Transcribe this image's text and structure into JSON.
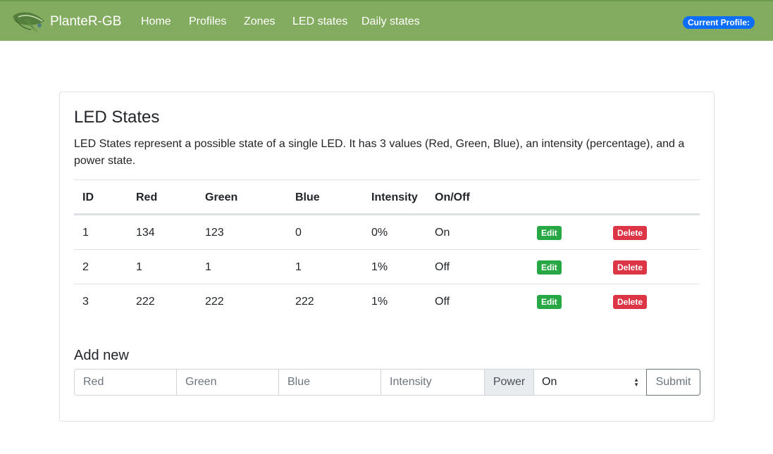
{
  "navbar": {
    "brand": "PlanteR-GB",
    "links": [
      "Home",
      "Profiles",
      "Zones",
      "LED states",
      "Daily states"
    ],
    "profile_badge": "Current Profile:",
    "logo_icon": "leaf-logo-icon",
    "background": "#84ac60"
  },
  "card": {
    "title": "LED States",
    "description": "LED States represent a possible state of a single LED. It has 3 values (Red, Green, Blue), an intensity (percentage), and a power state."
  },
  "table": {
    "headers": [
      "ID",
      "Red",
      "Green",
      "Blue",
      "Intensity",
      "On/Off"
    ],
    "rows": [
      [
        "1",
        "134",
        "123",
        "0",
        "0%",
        "On"
      ],
      [
        "2",
        "1",
        "1",
        "1",
        "1%",
        "Off"
      ],
      [
        "3",
        "222",
        "222",
        "222",
        "1%",
        "Off"
      ]
    ],
    "edit_label": "Edit",
    "delete_label": "Delete",
    "edit_color": "#28a745",
    "delete_color": "#dc3545"
  },
  "add_new": {
    "title": "Add new",
    "red_placeholder": "Red",
    "green_placeholder": "Green",
    "blue_placeholder": "Blue",
    "intensity_placeholder": "Intensity",
    "power_label": "Power",
    "power_selected": "On",
    "submit_label": "Submit"
  }
}
